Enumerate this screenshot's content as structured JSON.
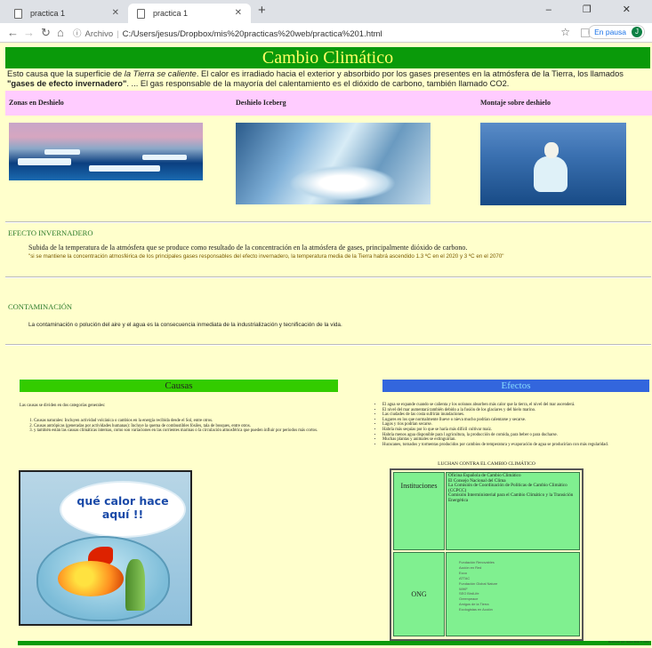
{
  "browser": {
    "tabs": [
      {
        "title": "practica 1",
        "active": false
      },
      {
        "title": "practica 1",
        "active": true
      }
    ],
    "new_tab": "+",
    "window_controls": "– ❐ ✕",
    "address": {
      "label": "Archivo",
      "url": "C:/Users/jesus/Dropbox/mis%20practicas%20web/practica%201.html"
    },
    "pause_label": "En pausa",
    "avatar_letter": "J"
  },
  "page": {
    "title": "Cambio Climático",
    "intro": {
      "p1": "Esto causa que la superficie de ",
      "em": "la Tierra se caliente",
      "p2": ". El calor es irradiado hacia el exterior y absorbido por los gases presentes en la atmósfera de la Tierra, los llamados ",
      "strong": "\"gases de efecto invernadero\"",
      "p3": ". ... El gas responsable de la mayoría del calentamiento es el dióxido de carbono, también llamado CO2."
    },
    "zones": [
      {
        "heading": "Zonas en Deshielo"
      },
      {
        "heading": "Deshielo Iceberg"
      },
      {
        "heading": "Montaje sobre deshielo"
      }
    ],
    "efecto": {
      "heading": "EFECTO INVERNADERO",
      "body": "Subida de la temperatura de la atmósfera que se produce como resultado de la concentración en la atmósfera de gases, principalmente dióxido de carbono.",
      "quote": "\"si se mantiene la concentración atmosférica de los principales gases responsables del efecto invernadero, la temperatura media de la Tierra habrá ascendido 1.3 ºC en el 2020 y 3 ºC en el 2070\""
    },
    "contaminacion": {
      "heading": "CONTAMINACIÓN",
      "body": "La contaminación o polución del aire y el agua es la consecuencia inmediata de la industrialización y tecnificación de la vida."
    },
    "causas": {
      "heading": "Causas",
      "intro": "Las causas se dividen en dos categorías generales:",
      "items": [
        "Causas naturales: Incluyen actividad volcánica o cambios en la energía recibida desde el Sol, entre otros.",
        "Causas antrópicas (generadas por actividades humanas): Incluye la quema de combustibles fósiles, tala de bosques, entre otros.",
        "y también están las causas climáticas internas, como son variaciones en las corrientes marinas o la circulación atmosférica que pueden influir por periodos más cortos."
      ],
      "image_text": {
        "line1": "qué calor hace",
        "line2": "aquí !!"
      }
    },
    "efectos": {
      "heading": "Efectos",
      "items": [
        "El agua se expande cuando se calienta y los océanos absorben más calor que la tierra, el nivel del mar ascenderá.",
        "El nivel del mar aumentará también debido a la fusión de los glaciares y del hielo marino.",
        "Las ciudades de las costa sufrirán inundaciones.",
        "Lugares en los que normalmente llueve o nieva mucho podrían calentarse y secarse.",
        "Lagos y ríos podrían secarse.",
        "Habría más sequías por lo que se haría más difícil cultivar maíz.",
        "Habría menos agua disponible para l agricultura, la producción de comida, para beber o para ducharse.",
        "Muchas plantas y animales se extinguirían.",
        "Huracanes, tornados y tormentas producidos por cambios de temperatura y evaporación de agua se producirían con más regularidad."
      ]
    },
    "luchan": {
      "title": "LUCHAN CONTRA EL CAMBIO CLIMÁTICO",
      "instituciones_label": "Instituciones",
      "instituciones": [
        "Oficina Española de Cambio Climático",
        "El Consejo Nacional del Clima",
        "La Comisión de Coordinación de Políticas de Cambio Climático (CCPCC)",
        "Comisión Interministerial para el Cambio Climático y la Transición Energética"
      ],
      "ong_label": "ONG",
      "ong": [
        "Fundación Renovables",
        "Acción en Red",
        "Ecoo",
        "ATTAC",
        "Fundación Global Nature",
        "WWF",
        "SEO BirdLife",
        "Greenpeace",
        "Amigos de la Tierra",
        "Ecologistas en Acción"
      ]
    },
    "footer": "Realizado por: Jesus Zoilo V. 2019"
  }
}
